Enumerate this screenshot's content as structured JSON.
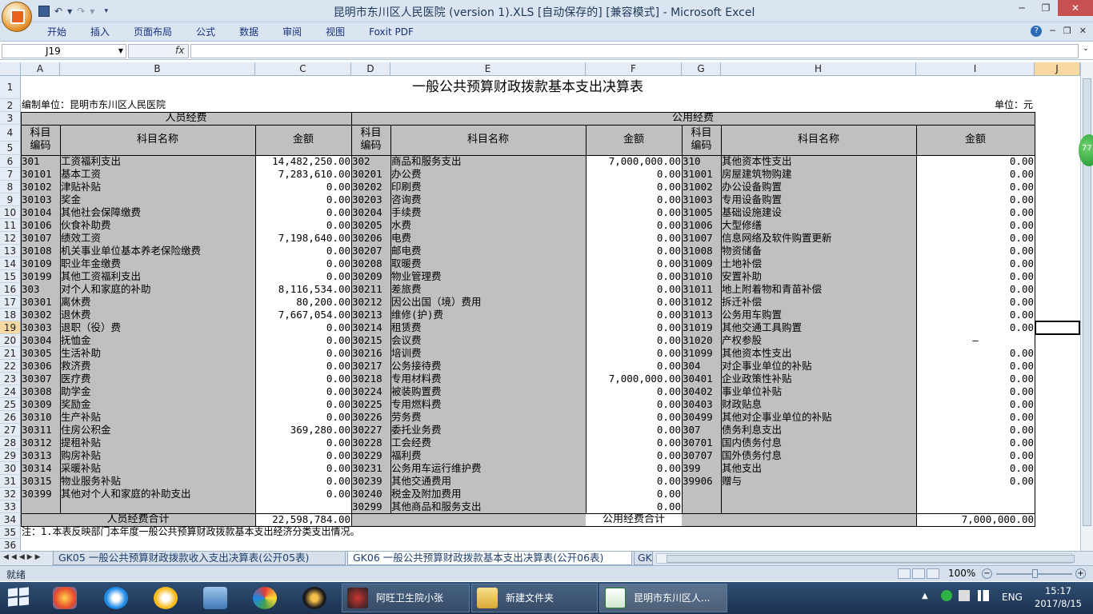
{
  "window": {
    "title": "昆明市东川区人民医院 (version 1).XLS [自动保存的]  [兼容模式] - Microsoft Excel"
  },
  "ribbon": {
    "tabs": [
      "开始",
      "插入",
      "页面布局",
      "公式",
      "数据",
      "审阅",
      "视图",
      "Foxit PDF"
    ]
  },
  "formula_bar": {
    "name_box": "J19",
    "fx": "fx",
    "content": ""
  },
  "columns": [
    "A",
    "B",
    "C",
    "D",
    "E",
    "F",
    "G",
    "H",
    "I",
    "J"
  ],
  "sheet": {
    "title": "一般公共预算财政拨款基本支出决算表",
    "unit_left": "编制单位：昆明市东川区人民医院",
    "unit_right": "单位：元",
    "personnel_header": "人员经费",
    "public_header": "公用经费",
    "code_hdr": "科目编码",
    "name_hdr": "科目名称",
    "amount_hdr": "金额",
    "personnel_total_label": "人员经费合计",
    "personnel_total_value": "22,598,784.00",
    "public_total_label": "公用经费合计",
    "public_total_value": "7,000,000.00",
    "note": "注：1.本表反映部门本年度一般公共预算财政拨款基本支出经济分类支出情况。",
    "cursor_mark": "—",
    "rows": [
      {
        "r": 6,
        "a": "301",
        "b": "工资福利支出",
        "c": "14,482,250.00",
        "d": "302",
        "e": "商品和服务支出",
        "f": "7,000,000.00",
        "g": "310",
        "h": "其他资本性支出",
        "i": "0.00"
      },
      {
        "r": 7,
        "a": "30101",
        "b": "  基本工资",
        "c": "7,283,610.00",
        "d": "30201",
        "e": "  办公费",
        "f": "0.00",
        "g": "31001",
        "h": "  房屋建筑物购建",
        "i": "0.00"
      },
      {
        "r": 8,
        "a": "30102",
        "b": "  津贴补贴",
        "c": "0.00",
        "d": "30202",
        "e": "  印刷费",
        "f": "0.00",
        "g": "31002",
        "h": "  办公设备购置",
        "i": "0.00"
      },
      {
        "r": 9,
        "a": "30103",
        "b": "  奖金",
        "c": "0.00",
        "d": "30203",
        "e": "  咨询费",
        "f": "0.00",
        "g": "31003",
        "h": "  专用设备购置",
        "i": "0.00"
      },
      {
        "r": 10,
        "a": "30104",
        "b": "  其他社会保障缴费",
        "c": "0.00",
        "d": "30204",
        "e": "  手续费",
        "f": "0.00",
        "g": "31005",
        "h": "  基础设施建设",
        "i": "0.00"
      },
      {
        "r": 11,
        "a": "30106",
        "b": "  伙食补助费",
        "c": "0.00",
        "d": "30205",
        "e": "  水费",
        "f": "0.00",
        "g": "31006",
        "h": "  大型修缮",
        "i": "0.00"
      },
      {
        "r": 12,
        "a": "30107",
        "b": "  绩效工资",
        "c": "7,198,640.00",
        "d": "30206",
        "e": "  电费",
        "f": "0.00",
        "g": "31007",
        "h": "  信息网络及软件购置更新",
        "i": "0.00"
      },
      {
        "r": 13,
        "a": "30108",
        "b": "  机关事业单位基本养老保险缴费",
        "c": "0.00",
        "d": "30207",
        "e": "  邮电费",
        "f": "0.00",
        "g": "31008",
        "h": "  物资储备",
        "i": "0.00"
      },
      {
        "r": 14,
        "a": "30109",
        "b": "  职业年金缴费",
        "c": "0.00",
        "d": "30208",
        "e": "  取暖费",
        "f": "0.00",
        "g": "31009",
        "h": "  土地补偿",
        "i": "0.00"
      },
      {
        "r": 15,
        "a": "30199",
        "b": "  其他工资福利支出",
        "c": "0.00",
        "d": "30209",
        "e": "  物业管理费",
        "f": "0.00",
        "g": "31010",
        "h": "  安置补助",
        "i": "0.00"
      },
      {
        "r": 16,
        "a": "303",
        "b": "对个人和家庭的补助",
        "c": "8,116,534.00",
        "d": "30211",
        "e": "  差旅费",
        "f": "0.00",
        "g": "31011",
        "h": "  地上附着物和青苗补偿",
        "i": "0.00"
      },
      {
        "r": 17,
        "a": "30301",
        "b": "  离休费",
        "c": "80,200.00",
        "d": "30212",
        "e": "  因公出国（境）费用",
        "f": "0.00",
        "g": "31012",
        "h": "  拆迁补偿",
        "i": "0.00"
      },
      {
        "r": 18,
        "a": "30302",
        "b": "  退休费",
        "c": "7,667,054.00",
        "d": "30213",
        "e": "  维修(护)费",
        "f": "0.00",
        "g": "31013",
        "h": "  公务用车购置",
        "i": "0.00"
      },
      {
        "r": 19,
        "a": "30303",
        "b": "  退职（役）费",
        "c": "0.00",
        "d": "30214",
        "e": "  租赁费",
        "f": "0.00",
        "g": "31019",
        "h": "  其他交通工具购置",
        "i": "0.00"
      },
      {
        "r": 20,
        "a": "30304",
        "b": "  抚恤金",
        "c": "0.00",
        "d": "30215",
        "e": "  会议费",
        "f": "0.00",
        "g": "31020",
        "h": "  产权参股",
        "i": ""
      },
      {
        "r": 21,
        "a": "30305",
        "b": "  生活补助",
        "c": "0.00",
        "d": "30216",
        "e": "  培训费",
        "f": "0.00",
        "g": "31099",
        "h": "  其他资本性支出",
        "i": "0.00"
      },
      {
        "r": 22,
        "a": "30306",
        "b": "  救济费",
        "c": "0.00",
        "d": "30217",
        "e": "  公务接待费",
        "f": "0.00",
        "g": "304",
        "h": "对企事业单位的补贴",
        "i": "0.00"
      },
      {
        "r": 23,
        "a": "30307",
        "b": "  医疗费",
        "c": "0.00",
        "d": "30218",
        "e": "  专用材料费",
        "f": "7,000,000.00",
        "g": "30401",
        "h": "  企业政策性补贴",
        "i": "0.00"
      },
      {
        "r": 24,
        "a": "30308",
        "b": "  助学金",
        "c": "0.00",
        "d": "30224",
        "e": "  被装购置费",
        "f": "0.00",
        "g": "30402",
        "h": "  事业单位补贴",
        "i": "0.00"
      },
      {
        "r": 25,
        "a": "30309",
        "b": "  奖励金",
        "c": "0.00",
        "d": "30225",
        "e": "  专用燃料费",
        "f": "0.00",
        "g": "30403",
        "h": "  财政贴息",
        "i": "0.00"
      },
      {
        "r": 26,
        "a": "30310",
        "b": "  生产补贴",
        "c": "0.00",
        "d": "30226",
        "e": "  劳务费",
        "f": "0.00",
        "g": "30499",
        "h": "  其他对企事业单位的补贴",
        "i": "0.00"
      },
      {
        "r": 27,
        "a": "30311",
        "b": "  住房公积金",
        "c": "369,280.00",
        "d": "30227",
        "e": "  委托业务费",
        "f": "0.00",
        "g": "307",
        "h": "债务利息支出",
        "i": "0.00"
      },
      {
        "r": 28,
        "a": "30312",
        "b": "  提租补贴",
        "c": "0.00",
        "d": "30228",
        "e": "  工会经费",
        "f": "0.00",
        "g": "30701",
        "h": "  国内债务付息",
        "i": "0.00"
      },
      {
        "r": 29,
        "a": "30313",
        "b": "  购房补贴",
        "c": "0.00",
        "d": "30229",
        "e": "  福利费",
        "f": "0.00",
        "g": "30707",
        "h": "  国外债务付息",
        "i": "0.00"
      },
      {
        "r": 30,
        "a": "30314",
        "b": "  采暖补贴",
        "c": "0.00",
        "d": "30231",
        "e": "  公务用车运行维护费",
        "f": "0.00",
        "g": "399",
        "h": "其他支出",
        "i": "0.00"
      },
      {
        "r": 31,
        "a": "30315",
        "b": "  物业服务补贴",
        "c": "0.00",
        "d": "30239",
        "e": "  其他交通费用",
        "f": "0.00",
        "g": "39906",
        "h": "  赠与",
        "i": "0.00"
      },
      {
        "r": 32,
        "a": "30399",
        "b": "  其他对个人和家庭的补助支出",
        "c": "0.00",
        "d": "30240",
        "e": "  税金及附加费用",
        "f": "0.00",
        "g": "",
        "h": "",
        "i": ""
      },
      {
        "r": 33,
        "a": "",
        "b": "",
        "c": "",
        "d": "30299",
        "e": "  其他商品和服务支出",
        "f": "0.00",
        "g": "",
        "h": "",
        "i": ""
      }
    ]
  },
  "sheet_tabs": [
    {
      "label": "GK05 一般公共预算财政拨款收入支出决算表(公开05表)",
      "active": false
    },
    {
      "label": "GK06 一般公共预算财政拨款基本支出决算表(公开06表)",
      "active": true
    },
    {
      "label": "GK",
      "active": false
    }
  ],
  "status": {
    "ready": "就绪",
    "zoom": "100%"
  },
  "taskbar": {
    "items": [
      "阿旺卫生院小张",
      "新建文件夹",
      "昆明市东川区人..."
    ],
    "lang": "ENG",
    "time": "15:17",
    "date": "2017/8/15"
  },
  "side_badge": "77"
}
